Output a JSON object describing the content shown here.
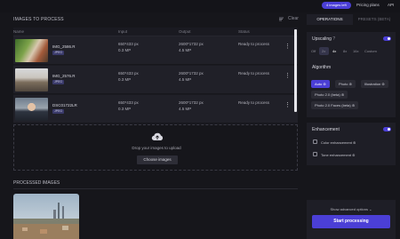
{
  "topbar": {
    "credits_label": "4 images left",
    "pricing_label": "Pricing plans",
    "api_label": "API"
  },
  "images": {
    "header": "IMAGES TO PROCESS",
    "clear_label": "Clear",
    "columns": [
      "Name",
      "Input",
      "Output",
      "Status"
    ],
    "rows": [
      {
        "name": "IMG_2586.R",
        "format": "JPEG",
        "input_dims": "650*433 px",
        "input_mp": "0.3 MP",
        "output_dims": "2600*1732 px",
        "output_mp": "4.5 MP",
        "status": "Ready to process"
      },
      {
        "name": "IMG_2576.R",
        "format": "JPEG",
        "input_dims": "650*433 px",
        "input_mp": "0.3 MP",
        "output_dims": "2600*1732 px",
        "output_mp": "4.5 MP",
        "status": "Ready to process"
      },
      {
        "name": "DSC01722LR",
        "format": "JPEG",
        "input_dims": "650*433 px",
        "input_mp": "0.3 MP",
        "output_dims": "2600*1732 px",
        "output_mp": "4.5 MP",
        "status": "Ready to process"
      }
    ]
  },
  "dropzone": {
    "text": "Drop your images to upload",
    "button_label": "Choose images"
  },
  "processed": {
    "header": "PROCESSED IMAGES"
  },
  "tabs": {
    "operations": "OPERATIONS",
    "presets": "PRESETS (BETA)"
  },
  "upscaling": {
    "title": "Upscaling",
    "info": "?",
    "options": [
      "Off",
      "2x",
      "4x",
      "8x",
      "16x",
      "Custom"
    ],
    "selected": "4x"
  },
  "algorithm": {
    "title": "Algorithm",
    "options": [
      "Auto",
      "Photo",
      "Illustration",
      "Photo 2.0 (beta)",
      "Photo 2.0 Faces (beta)"
    ],
    "selected": "Auto"
  },
  "enhancement": {
    "title": "Enhancement",
    "options": [
      "Color enhancement",
      "Tone enhancement"
    ]
  },
  "actions": {
    "advanced_label": "Show advanced options",
    "start_label": "Start processing"
  },
  "colors": {
    "accent": "#4b3fd6",
    "background": "#16161b"
  }
}
